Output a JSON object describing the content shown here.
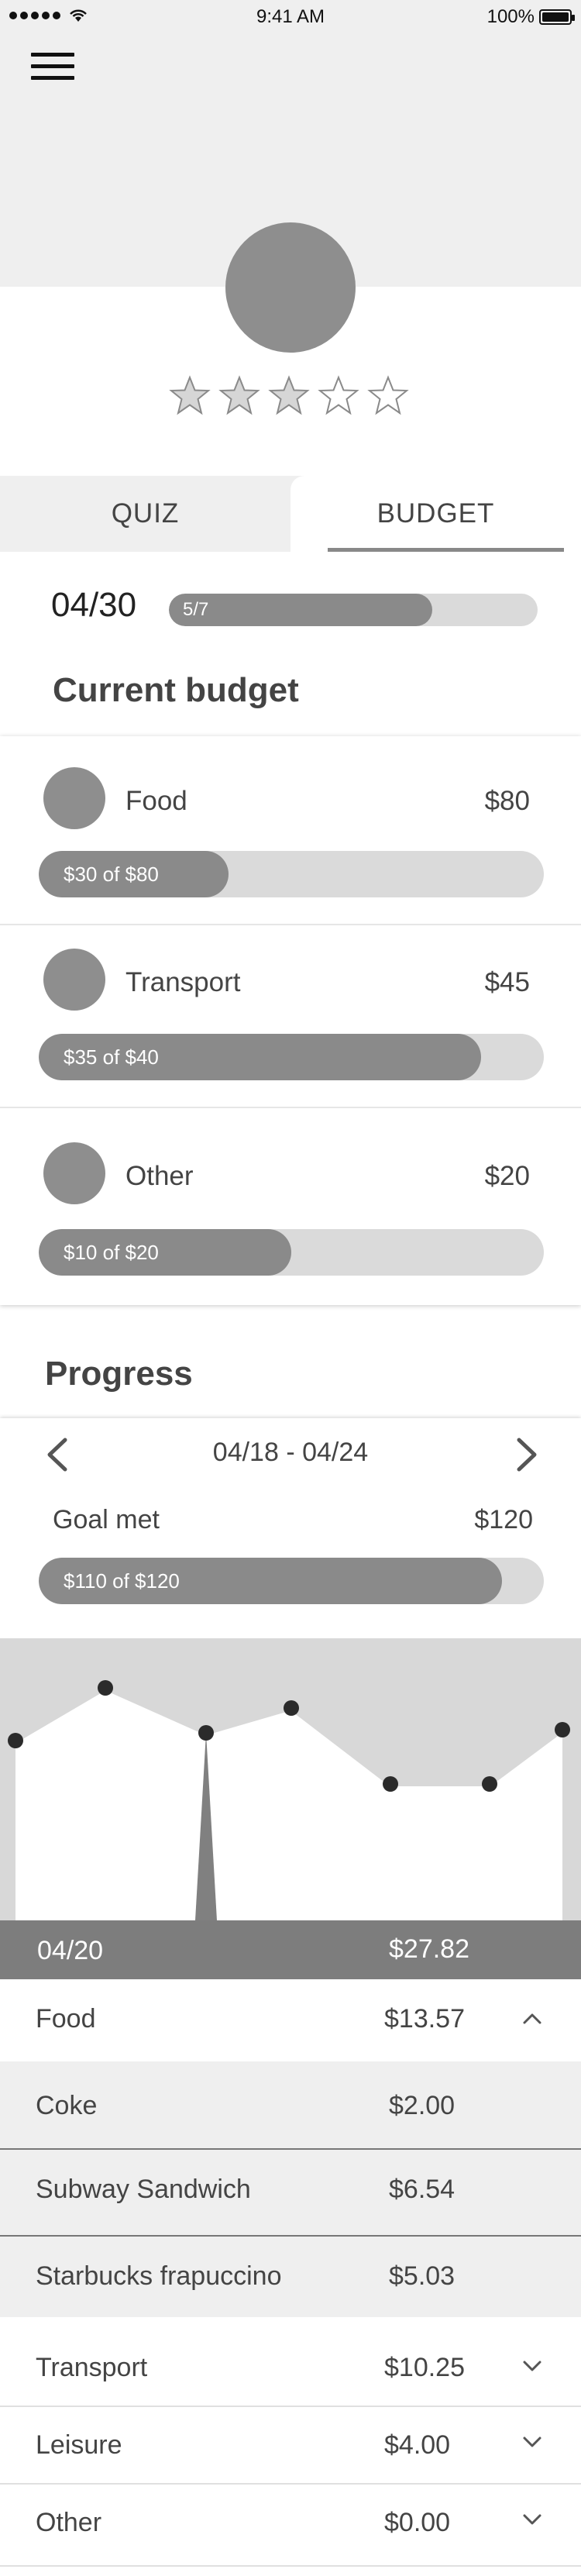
{
  "status_bar": {
    "time": "9:41 AM",
    "battery": "100%"
  },
  "profile": {
    "rating": 3,
    "max_rating": 5
  },
  "tabs": [
    {
      "label": "QUIZ",
      "active": false
    },
    {
      "label": "BUDGET",
      "active": true
    }
  ],
  "day": {
    "date": "04/30",
    "progress_label": "5/7",
    "progress_fraction": 0.714
  },
  "current_budget": {
    "heading": "Current budget",
    "items": [
      {
        "name": "Food",
        "amount": "$80",
        "bar_label": "$30 of $80",
        "fraction": 0.375
      },
      {
        "name": "Transport",
        "amount": "$45",
        "bar_label": "$35 of $40",
        "fraction": 0.875
      },
      {
        "name": "Other",
        "amount": "$20",
        "bar_label": "$10 of $20",
        "fraction": 0.5
      }
    ]
  },
  "progress": {
    "heading": "Progress",
    "week_range": "04/18 - 04/24",
    "goal_label": "Goal met",
    "goal_amount": "$120",
    "goal_bar_label": "$110 of $120",
    "goal_fraction": 0.917
  },
  "selected_day": {
    "date": "04/20",
    "total": "$27.82"
  },
  "expenses": [
    {
      "name": "Food",
      "amount": "$13.57",
      "expanded": true,
      "items": [
        {
          "name": "Coke",
          "amount": "$2.00"
        },
        {
          "name": "Subway Sandwich",
          "amount": "$6.54"
        },
        {
          "name": "Starbucks frapuccino",
          "amount": "$5.03"
        }
      ]
    },
    {
      "name": "Transport",
      "amount": "$10.25",
      "expanded": false
    },
    {
      "name": "Leisure",
      "amount": "$4.00",
      "expanded": false
    },
    {
      "name": "Other",
      "amount": "$0.00",
      "expanded": false
    }
  ],
  "colors": {
    "accent_gray": "#8a8a8a",
    "track_gray": "#dadada",
    "panel_gray": "#efefef"
  }
}
